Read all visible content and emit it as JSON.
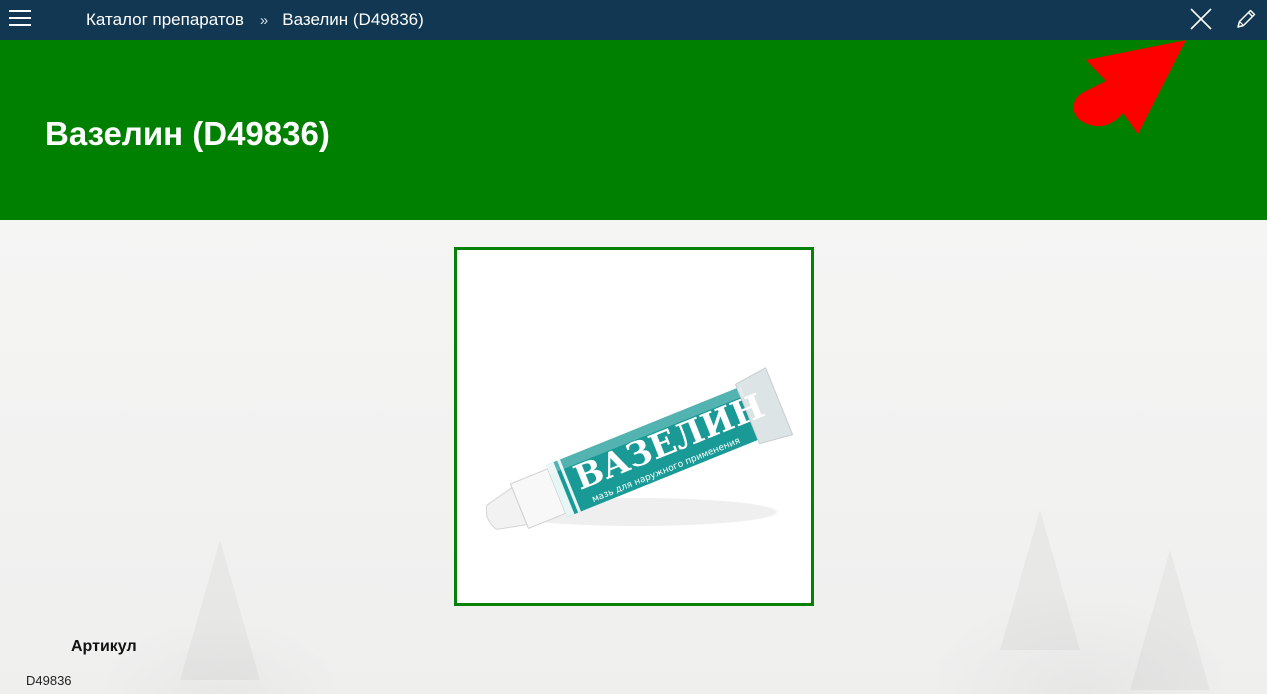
{
  "topbar": {
    "menu_icon": "hamburger-menu-icon",
    "breadcrumb": [
      {
        "label": "Каталог препаратов"
      },
      {
        "label": "Вазелин (D49836)"
      }
    ],
    "separator": "»",
    "close_icon": "close-icon",
    "edit_icon": "pencil-icon"
  },
  "header": {
    "title": "Вазелин (D49836)",
    "color": "#008000"
  },
  "product_image": {
    "brand_text": "ВАЗЕЛИН",
    "subtitle_text": "мазь для наружного применения",
    "tube_color": "#1a9a96"
  },
  "fields": [
    {
      "label": "Артикул",
      "value": "D49836"
    }
  ],
  "colors": {
    "topbar": "#113752",
    "accent": "#008000",
    "arrow": "#ff0000"
  }
}
